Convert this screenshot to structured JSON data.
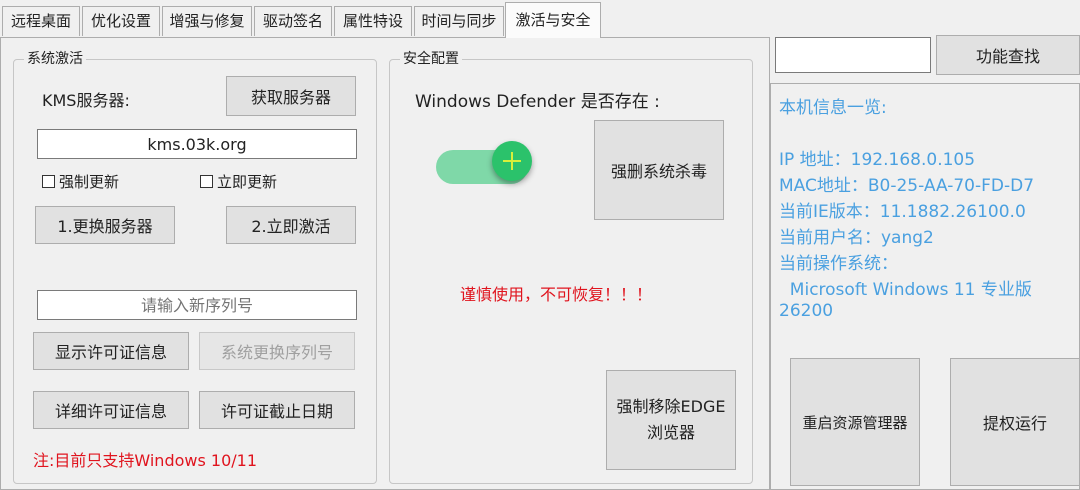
{
  "tabs": [
    "远程桌面",
    "优化设置",
    "增强与修复",
    "驱动签名",
    "属性特设",
    "时间与同步",
    "激活与安全"
  ],
  "activation": {
    "legend": "系统激活",
    "kms_label": "KMS服务器:",
    "get_server_button": "获取服务器",
    "server_value": "kms.03k.org",
    "force_update_label": "强制更新",
    "instant_update_label": "立即更新",
    "change_server_button": "1.更换服务器",
    "activate_now_button": "2.立即激活",
    "serial_placeholder": "请输入新序列号",
    "show_license_button": "显示许可证信息",
    "change_serial_button": "系统更换序列号",
    "detail_license_button": "详细许可证信息",
    "license_expiry_button": "许可证截止日期",
    "note": "注:目前只支持Windows 10/11"
  },
  "security": {
    "legend": "安全配置",
    "defender_label": "Windows Defender 是否存在 :",
    "defender_toggle_on": true,
    "force_delete_av_button": "强删系统杀毒",
    "warning": "谨慎使用，不可恢复！！！",
    "remove_edge_button_line1": "强制移除EDGE",
    "remove_edge_button_line2": "浏览器"
  },
  "search": {
    "value": "",
    "button": "功能查找"
  },
  "info": {
    "title": "本机信息一览:",
    "ip": "IP 地址：192.168.0.105",
    "mac": "MAC地址：B0-25-AA-70-FD-D7",
    "ie": "当前IE版本：11.1882.26100.0",
    "user": "当前用户名：yang2",
    "os_label": "当前操作系统：",
    "os_name": "  Microsoft Windows 11 专业版",
    "os_build": "26200"
  },
  "bottom_buttons": {
    "restart_explorer": "重启资源管理器",
    "elevate_run": "提权运行"
  }
}
